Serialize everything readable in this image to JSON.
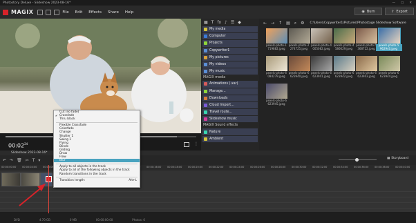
{
  "app": {
    "window_title": "Photostory Deluxe - Slideshow 2023-08-16*",
    "logo": "MAGIX"
  },
  "menu": [
    "File",
    "Edit",
    "Effects",
    "Share",
    "Help"
  ],
  "actions": {
    "burn": "Burn",
    "export": "Export"
  },
  "preview": {
    "timecode": "00:02",
    "timecode_frames": "24",
    "progress": 0.9
  },
  "media_categories": {
    "group1": [
      "My media",
      "Computer",
      "Projects",
      "Copywriter1",
      "My pictures",
      "My videos",
      "My music"
    ],
    "magix_media_header": "MAGIX media",
    "group2": [
      "Animations (.xar)",
      "Manage...",
      "Downloads",
      "Cloud Import...",
      "Travel route...",
      "Slideshow music"
    ],
    "sound_effects_header": "MAGIX Sound effects",
    "group3": [
      "Nature",
      "Ambient"
    ]
  },
  "files": {
    "path": "C:\\Users\\Copywriter1\\Pictures\\Photostage Slideshow Software",
    "items": [
      "pexels-photo-1\n719882.jpeg",
      "pexels-photo-2\n274725.jpeg",
      "pexels-photo-4\n005082.jpeg",
      "pexels-photo-4\n586629.jpeg",
      "pexels-photo-5\n368722.jpeg",
      "pexels-photo-5\n962940.jpeg",
      "pexels-photo-6\n084279.jpeg",
      "pexels-photo-6\n623940.jpeg",
      "pexels-photo-6\n623941.jpeg",
      "pexels-photo-6\n623942.jpeg",
      "pexels-photo-6\n623943.jpeg",
      "pexels-photo-6\n623944.jpeg",
      "pexels-photo-6\n623945.jpeg"
    ]
  },
  "context_menu": {
    "items": [
      {
        "label": "Cut (no fade)",
        "checked": false
      },
      {
        "label": "Crossfade",
        "checked": true
      },
      {
        "label": "Thru black",
        "checked": false
      },
      {
        "sep": true
      },
      {
        "label": "Flexible Crossfade",
        "checked": false
      },
      {
        "label": "Colorfade",
        "checked": false
      },
      {
        "label": "Change",
        "checked": false
      },
      {
        "label": "Shutter 1",
        "checked": false
      },
      {
        "label": "Swing 1",
        "checked": false
      },
      {
        "label": "Flying",
        "checked": false
      },
      {
        "label": "Blinds",
        "checked": false
      },
      {
        "label": "Gliding",
        "checked": false
      },
      {
        "label": "Draw",
        "checked": false
      },
      {
        "label": "Flow",
        "checked": false
      },
      {
        "label": "Blur",
        "checked": false,
        "highlight": true
      },
      {
        "sep": true
      },
      {
        "label": "Apply to all objects in the track",
        "checked": false
      },
      {
        "label": "Apply to all of the following objects in the track",
        "checked": false
      },
      {
        "label": "Random transitions in the track",
        "checked": false
      },
      {
        "sep": true
      },
      {
        "label": "Transition length:",
        "shortcut": "Alt+L",
        "checked": false
      }
    ]
  },
  "storyboard": {
    "title": "Slideshow 2023-08-16*",
    "button": "Storyboard",
    "zoom": 0.48,
    "ruler_ticks": [
      "00:00:00:00",
      "00:00:04:00",
      "00:00:06:00",
      "00:00:08:00",
      "00:00:10:00",
      "00:00:12:00",
      "00:00:14:00",
      "00:00:16:00",
      "00:00:18:00",
      "00:00:20:00",
      "00:00:22:00",
      "00:00:24:00",
      "00:00:26:00",
      "00:00:28:00",
      "00:00:30:00",
      "00:00:32:00",
      "00:00:34:00",
      "00:00:36:00",
      "00:00:38:00",
      "00:00:40:00"
    ]
  },
  "status": [
    "DVD",
    "4.70 GB",
    "0 MB",
    "00:00:00:00",
    "Photos: 6"
  ],
  "colors": {
    "accent_blue": "#3a4f7a",
    "highlight": "#49a3bf",
    "arrow": "#d8232a"
  }
}
